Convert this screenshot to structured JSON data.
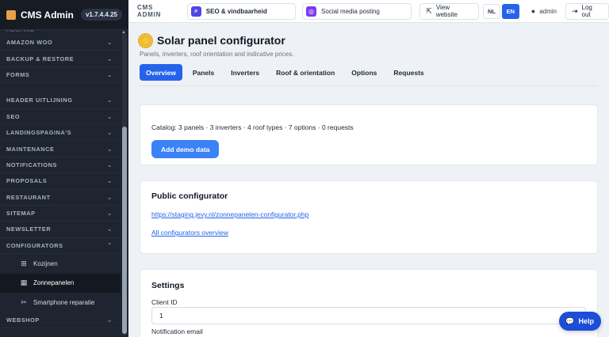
{
  "sidebar": {
    "title": "CMS Admin",
    "version": "v1.7.4.4.25",
    "cut_item": "HOSTING",
    "groups_top": [
      "AMAZON WOO",
      "BACKUP & RESTORE",
      "FORMS"
    ],
    "groups_mid": [
      "HEADER UITLIJNING",
      "SEO",
      "LANDINGSPAGINA'S",
      "MAINTENANCE",
      "NOTIFICATIONS",
      "PROPOSALS",
      "RESTAURANT",
      "SITEMAP",
      "NEWSLETTER",
      "CONFIGURATORS"
    ],
    "sub_items": [
      {
        "label": "Kozijnen",
        "icon": "grid-icon"
      },
      {
        "label": "Zonnepanelen",
        "icon": "solar-panel-icon"
      },
      {
        "label": "Smartphone reparatie",
        "icon": "tools-icon"
      }
    ],
    "groups_bottom": [
      "WEBSHOP"
    ]
  },
  "topbar": {
    "label": "CMS ADMIN",
    "seo_link": "SEO & vindbaarheid",
    "social_link": "Social media posting",
    "view_website": "View website",
    "lang_nl": "NL",
    "lang_en": "EN",
    "user": "admin",
    "logout": "Log out"
  },
  "page": {
    "title": "Solar panel configurator",
    "subtitle": "Panels, inverters, roof orientation and indicative prices.",
    "tabs": [
      "Overview",
      "Panels",
      "Inverters",
      "Roof & orientation",
      "Options",
      "Requests"
    ],
    "catalog": "Catalog: 3 panels · 3 inverters · 4 roof types · 7 options · 0 requests",
    "demo_button": "Add demo data",
    "public_title": "Public configurator",
    "public_link": "https://staging.jevy.nl/zonnepanelen-configurator.php",
    "overview_link": "All configurators overview",
    "settings_title": "Settings",
    "client_id_label": "Client ID",
    "client_id_value": "1",
    "notification_label": "Notification email"
  },
  "help": "Help"
}
